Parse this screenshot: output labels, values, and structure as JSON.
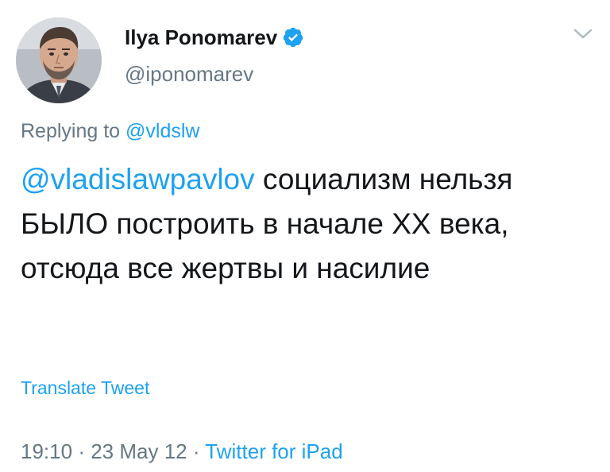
{
  "author": {
    "display_name": "Ilya Ponomarev",
    "handle": "@iponomarev",
    "verified": true
  },
  "icons": {
    "avatar": "profile-photo",
    "verified": "verified-badge-icon",
    "menu": "chevron-down-icon"
  },
  "reply": {
    "prefix": "Replying to",
    "mention": "@vldslw"
  },
  "tweet": {
    "mention": "@vladislawpavlov",
    "text": "социализм нельзя БЫЛО построить в начале XX века, отсюда все жертвы и насилие"
  },
  "translate_label": "Translate Tweet",
  "meta": {
    "time": "19:10",
    "sep1": "·",
    "date": "23 May 12",
    "sep2": "·",
    "source": "Twitter for iPad"
  },
  "colors": {
    "link": "#1da1f2",
    "secondary": "#657786",
    "text": "#14171a"
  }
}
